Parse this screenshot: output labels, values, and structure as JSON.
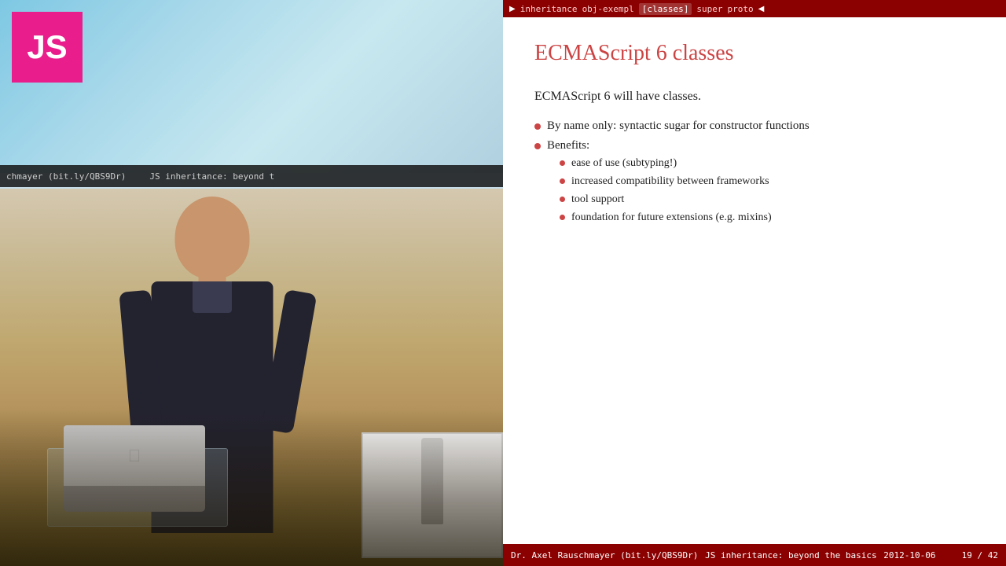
{
  "video": {
    "js_logo": "JS",
    "screen_left_text": "chmayer  (bit.ly/QBS9Dr)",
    "screen_right_text": "JS inheritance: beyond t"
  },
  "slide": {
    "nav": {
      "play_icon": "▶",
      "items": [
        "inheritance",
        "obj-exempl",
        "[classes]",
        "super",
        "proto"
      ],
      "back_icon": "◀"
    },
    "title": "ECMAScript 6 classes",
    "intro": "ECMAScript 6 will have classes.",
    "bullets": [
      {
        "text": "By name only: syntactic sugar for constructor functions",
        "sub": []
      },
      {
        "text": "Benefits:",
        "sub": [
          "ease of use (subtyping!)",
          "increased compatibility between frameworks",
          "tool support",
          "foundation for future extensions (e.g.  mixins)"
        ]
      }
    ],
    "footer": {
      "left": "Dr. Axel Rauschmayer  (bit.ly/QBS9Dr)",
      "center": "JS inheritance: beyond the basics",
      "date": "2012-10-06",
      "pages": "19 / 42"
    }
  }
}
